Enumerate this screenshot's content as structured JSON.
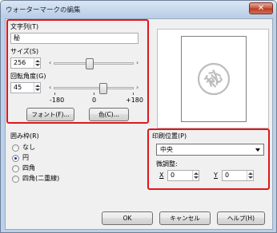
{
  "window": {
    "title": "ウォーターマークの編集",
    "close_glyph": "✕"
  },
  "text_field": {
    "label": "文字列(T)",
    "value": "秘"
  },
  "size": {
    "label": "サイズ(S)",
    "value": "256",
    "slider_fraction": 0.45
  },
  "rotation": {
    "label": "回転角度(G)",
    "value": "45",
    "slider_fraction": 0.62,
    "scale_min": "-180",
    "scale_mid": "0",
    "scale_max": "+180"
  },
  "buttons": {
    "font": "フォント(F)...",
    "color": "色(C)...",
    "ok": "OK",
    "cancel": "キャンセル",
    "help": "ヘルプ(H)"
  },
  "frame": {
    "label": "囲み枠(R)",
    "options": [
      "なし",
      "円",
      "四角",
      "四角(二重線)"
    ],
    "selected_index": 1
  },
  "preview": {
    "glyph": "秘"
  },
  "position": {
    "label": "印刷位置(P)",
    "selected": "中央",
    "fine_label": "微調整:",
    "x_label": "X",
    "x_value": "0",
    "y_label": "Y",
    "y_value": "0"
  },
  "colors": {
    "highlight": "#e0161c",
    "stamp": "#bdbdbd"
  }
}
